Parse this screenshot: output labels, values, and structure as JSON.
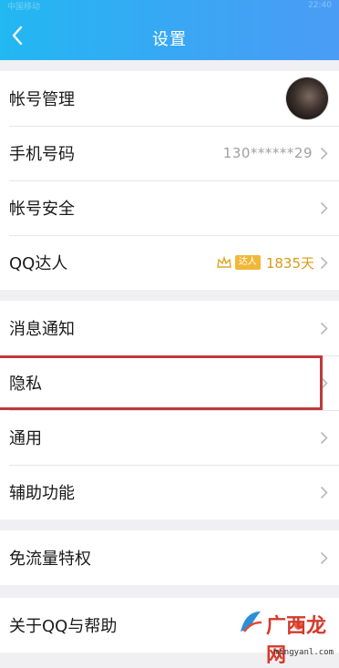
{
  "header": {
    "title": "设置",
    "status_left": "中国移动",
    "status_right": "22:40"
  },
  "group1": [
    {
      "id": "account",
      "label": "帐号管理"
    },
    {
      "id": "phone",
      "label": "手机号码",
      "value": "130******29"
    },
    {
      "id": "security",
      "label": "帐号安全"
    },
    {
      "id": "qq-expert",
      "label": "QQ达人",
      "badge": "达人",
      "days": "1835天"
    }
  ],
  "group2": [
    {
      "id": "notifications",
      "label": "消息通知"
    },
    {
      "id": "privacy",
      "label": "隐私"
    },
    {
      "id": "general",
      "label": "通用"
    },
    {
      "id": "accessibility",
      "label": "辅助功能"
    }
  ],
  "group3": [
    {
      "id": "data-free",
      "label": "免流量特权"
    }
  ],
  "group4": [
    {
      "id": "about",
      "label": "关于QQ与帮助"
    }
  ],
  "watermark": {
    "brand": "广西龙网",
    "url": "mingyanl.com"
  },
  "colors": {
    "header": "#2fb0f3",
    "highlight_box": "#c0383d",
    "badge_gold": "#f0b838",
    "notification_dot": "#ee5a3a"
  }
}
